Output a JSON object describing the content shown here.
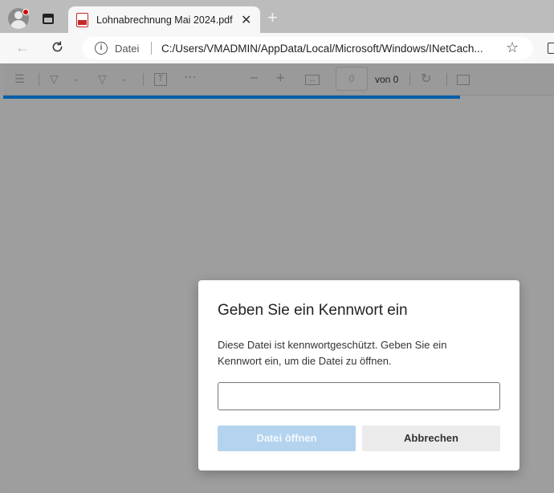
{
  "browser": {
    "tab": {
      "title": "Lohnabrechnung Mai 2024.pdf",
      "close": "✕"
    },
    "new_tab": "+",
    "address": {
      "scheme_label": "Datei",
      "url": "C:/Users/VMADMIN/AppData/Local/Microsoft/Windows/INetCach..."
    },
    "accent": "#005fa8"
  },
  "pdf_toolbar": {
    "page_input_value": "0",
    "page_total": "von 0"
  },
  "dialog": {
    "title": "Geben Sie ein Kennwort ein",
    "message": "Diese Datei ist kennwortgeschützt. Geben Sie ein Kennwort ein, um die Datei zu öffnen.",
    "password_value": "",
    "open_button": "Datei öffnen",
    "cancel_button": "Abbrechen"
  }
}
